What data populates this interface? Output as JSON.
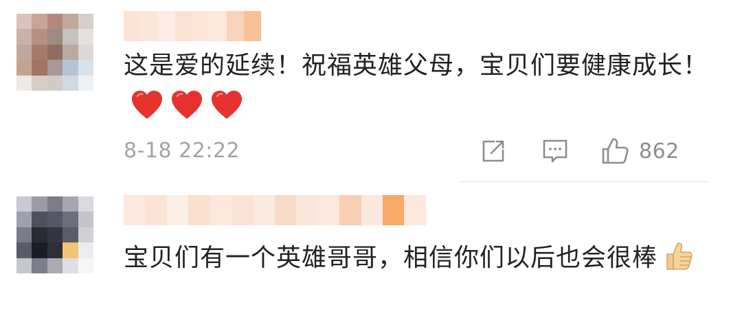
{
  "comments": [
    {
      "content_text": "这是爱的延续！祝福英雄父母，宝贝们要健康成长！",
      "emoji": [
        "red-heart",
        "red-heart",
        "red-heart"
      ],
      "timestamp": "8-18 22:22",
      "like_count": "862",
      "avatar_colors": [
        "#d9c3ba",
        "#c9a393",
        "#b4897c",
        "#c3a69c",
        "#d8cfcb",
        "#ccb2a6",
        "#b39283",
        "#9d8a83",
        "#c7c0bd",
        "#e4e1e0",
        "#bfa89e",
        "#a37c6c",
        "#8e6e62",
        "#b9aaa4",
        "#dcd8d6",
        "#c4a392",
        "#a17562",
        "#a99895",
        "#b4c4d5",
        "#d7e2ec",
        "#ece9e7",
        "#d8ccc6",
        "#d3cac6",
        "#cfd8e3",
        "#eef1f4"
      ],
      "username_colors": [
        "#fde3d6",
        "#fbe6da",
        "#fdece3",
        "#fbe2d3",
        "#fce5d7",
        "#fbe8dc",
        "#f9d3bb",
        "#f8c296"
      ]
    },
    {
      "content_text": "宝贝们有一个英雄哥哥，相信你们以后也会很棒",
      "emoji": [
        "thumbs-up"
      ],
      "avatar_colors": [
        "#c9c9d1",
        "#9a9ba6",
        "#7d7d89",
        "#a5a6b1",
        "#d9dadf",
        "#9ea0ab",
        "#4f505b",
        "#555666",
        "#6c6e7a",
        "#c4c5cc",
        "#7b7c88",
        "#2a2a33",
        "#33343f",
        "#5b5c66",
        "#d0d0d6",
        "#5b5c67",
        "#1c1c23",
        "#2e2e37",
        "#f2c371",
        "#ececef",
        "#c7c8cf",
        "#7c7d88",
        "#a9aab2",
        "#dfdfe3",
        "#f6f6f7"
      ],
      "username_colors": [
        "#fde9de",
        "#fbe3d6",
        "#fdeee6",
        "#fbe0d0",
        "#fce7db",
        "#fae3d4",
        "#fbe9de",
        "#f8dac7",
        "#fbe6da",
        "#fde8dc",
        "#f8d0b4",
        "#fce9de",
        "#f7a965",
        "#fbe7db"
      ]
    }
  ],
  "colors": {
    "text": "#222222",
    "meta": "#a3a3a3",
    "icon": "#8d8d8d",
    "heart": "#e5322d"
  }
}
